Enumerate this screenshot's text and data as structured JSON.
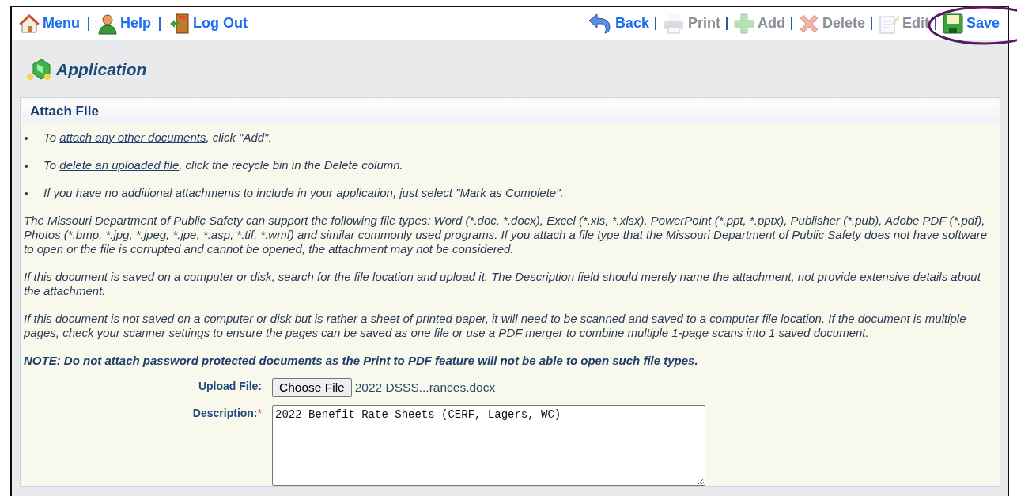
{
  "toolbar": {
    "left": [
      {
        "kind": "home",
        "label": "Menu",
        "disabled": false
      },
      {
        "kind": "help",
        "label": "Help",
        "disabled": false
      },
      {
        "kind": "logout",
        "label": "Log Out",
        "disabled": false
      }
    ],
    "right": [
      {
        "kind": "back",
        "label": "Back",
        "disabled": false
      },
      {
        "kind": "print",
        "label": "Print",
        "disabled": true
      },
      {
        "kind": "add",
        "label": "Add",
        "disabled": true
      },
      {
        "kind": "delete",
        "label": "Delete",
        "disabled": true
      },
      {
        "kind": "edit",
        "label": "Edit",
        "disabled": true
      },
      {
        "kind": "save",
        "label": "Save",
        "disabled": false
      }
    ]
  },
  "highlight": {
    "kind": "ellipse"
  },
  "page_title": "Application",
  "panel": {
    "title": "Attach File",
    "bullets": [
      {
        "before": "To ",
        "link": "attach any other documents",
        "after": ", click \"Add\"."
      },
      {
        "before": "To ",
        "link": "delete an uploaded file",
        "after": ", click the recycle bin in the Delete column."
      },
      {
        "before": "If you have no additional attachments to include in your application, just select \"Mark as Complete\"."
      }
    ],
    "paragraphs": [
      "The Missouri Department of Public Safety can support the following file types: Word (*.doc, *.docx), Excel (*.xls, *.xlsx), PowerPoint (*.ppt, *.pptx), Publisher (*.pub), Adobe PDF (*.pdf), Photos (*.bmp, *.jpg, *.jpeg, *.jpe, *.asp, *.tif, *.wmf) and similar commonly used programs. If you attach a file type that the Missouri Department of Public Safety does not have software to open or the file is corrupted and cannot be opened, the attachment may not be considered.",
      "If this document is saved on a computer or disk, search for the file location and upload it. The Description field should merely name the attachment, not provide extensive details about the attachment.",
      "If this document is not saved on a computer or disk but is rather a sheet of printed paper, it will need to be scanned and saved to a computer file location. If the document is multiple pages, check your scanner settings to ensure the pages can be saved as one file or use a PDF merger to combine multiple 1-page scans into 1 saved document."
    ],
    "note": "NOTE: Do not attach password protected documents as the Print to PDF feature will not be able to open such file types.",
    "upload": {
      "label": "Upload File:",
      "button": "Choose File",
      "file_name": "2022 DSSS...rances.docx"
    },
    "description": {
      "label": "Description:",
      "required_mark": "*",
      "value": "2022 Benefit Rate Sheets (CERF, Lagers, WC)"
    }
  }
}
